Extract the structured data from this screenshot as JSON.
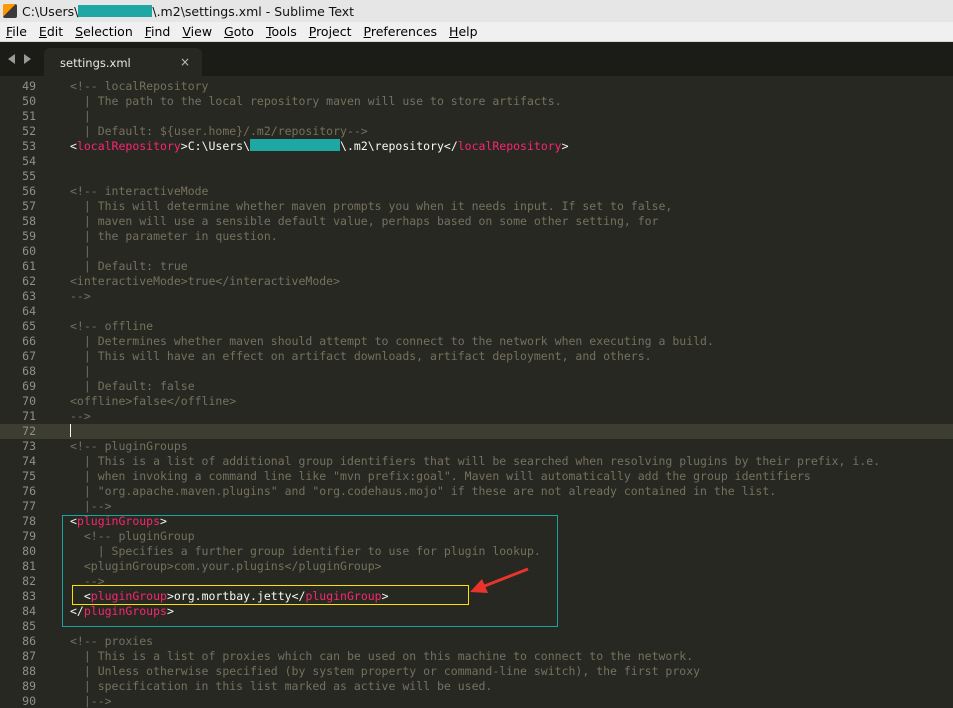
{
  "window": {
    "title_prefix": "C:\\Users\\",
    "title_suffix": "\\.m2\\settings.xml - Sublime Text"
  },
  "menu": [
    "File",
    "Edit",
    "Selection",
    "Find",
    "View",
    "Goto",
    "Tools",
    "Project",
    "Preferences",
    "Help"
  ],
  "tab": {
    "label": "settings.xml",
    "close": "×"
  },
  "editor": {
    "current_line": 72,
    "lines": [
      {
        "n": "49",
        "s": [
          [
            "c",
            "<!-- localRepository"
          ]
        ]
      },
      {
        "n": "50",
        "s": [
          [
            "c",
            "  | The path to the local repository maven will use to store artifacts."
          ]
        ]
      },
      {
        "n": "51",
        "s": [
          [
            "c",
            "  |"
          ]
        ]
      },
      {
        "n": "52",
        "s": [
          [
            "c",
            "  | Default: ${user.home}/.m2/repository-->"
          ]
        ]
      },
      {
        "n": "53",
        "s": [
          [
            "p",
            "<"
          ],
          [
            "t",
            "localRepository"
          ],
          [
            "p",
            ">C:\\Users\\"
          ],
          [
            "r",
            ""
          ],
          [
            "p",
            "\\.m2\\repository</"
          ],
          [
            "t",
            "localRepository"
          ],
          [
            "p",
            ">"
          ]
        ]
      },
      {
        "n": "54",
        "s": []
      },
      {
        "n": "55",
        "s": []
      },
      {
        "n": "56",
        "s": [
          [
            "c",
            "<!-- interactiveMode"
          ]
        ]
      },
      {
        "n": "57",
        "s": [
          [
            "c",
            "  | This will determine whether maven prompts you when it needs input. If set to false,"
          ]
        ]
      },
      {
        "n": "58",
        "s": [
          [
            "c",
            "  | maven will use a sensible default value, perhaps based on some other setting, for"
          ]
        ]
      },
      {
        "n": "59",
        "s": [
          [
            "c",
            "  | the parameter in question."
          ]
        ]
      },
      {
        "n": "60",
        "s": [
          [
            "c",
            "  |"
          ]
        ]
      },
      {
        "n": "61",
        "s": [
          [
            "c",
            "  | Default: true"
          ]
        ]
      },
      {
        "n": "62",
        "s": [
          [
            "c",
            "<interactiveMode>true</interactiveMode>"
          ]
        ]
      },
      {
        "n": "63",
        "s": [
          [
            "c",
            "-->"
          ]
        ]
      },
      {
        "n": "64",
        "s": []
      },
      {
        "n": "65",
        "s": [
          [
            "c",
            "<!-- offline"
          ]
        ]
      },
      {
        "n": "66",
        "s": [
          [
            "c",
            "  | Determines whether maven should attempt to connect to the network when executing a build."
          ]
        ]
      },
      {
        "n": "67",
        "s": [
          [
            "c",
            "  | This will have an effect on artifact downloads, artifact deployment, and others."
          ]
        ]
      },
      {
        "n": "68",
        "s": [
          [
            "c",
            "  |"
          ]
        ]
      },
      {
        "n": "69",
        "s": [
          [
            "c",
            "  | Default: false"
          ]
        ]
      },
      {
        "n": "70",
        "s": [
          [
            "c",
            "<offline>false</offline>"
          ]
        ]
      },
      {
        "n": "71",
        "s": [
          [
            "c",
            "-->"
          ]
        ]
      },
      {
        "n": "72",
        "s": []
      },
      {
        "n": "73",
        "s": [
          [
            "c",
            "<!-- pluginGroups"
          ]
        ]
      },
      {
        "n": "74",
        "s": [
          [
            "c",
            "  | This is a list of additional group identifiers that will be searched when resolving plugins by their prefix, i.e."
          ]
        ]
      },
      {
        "n": "75",
        "s": [
          [
            "c",
            "  | when invoking a command line like \"mvn prefix:goal\". Maven will automatically add the group identifiers"
          ]
        ]
      },
      {
        "n": "76",
        "s": [
          [
            "c",
            "  | \"org.apache.maven.plugins\" and \"org.codehaus.mojo\" if these are not already contained in the list."
          ]
        ]
      },
      {
        "n": "77",
        "s": [
          [
            "c",
            "  |-->"
          ]
        ]
      },
      {
        "n": "78",
        "s": [
          [
            "p",
            "<"
          ],
          [
            "t",
            "pluginGroups"
          ],
          [
            "p",
            ">"
          ]
        ]
      },
      {
        "n": "79",
        "s": [
          [
            "c",
            "  <!-- pluginGroup"
          ]
        ]
      },
      {
        "n": "80",
        "s": [
          [
            "c",
            "    | Specifies a further group identifier to use for plugin lookup."
          ]
        ]
      },
      {
        "n": "81",
        "s": [
          [
            "c",
            "  <pluginGroup>com.your.plugins</pluginGroup>"
          ]
        ]
      },
      {
        "n": "82",
        "s": [
          [
            "c",
            "  -->"
          ]
        ]
      },
      {
        "n": "83",
        "s": [
          [
            "p",
            "  <"
          ],
          [
            "t",
            "pluginGroup"
          ],
          [
            "p",
            ">org.mortbay.jetty</"
          ],
          [
            "t",
            "pluginGroup"
          ],
          [
            "p",
            ">"
          ]
        ]
      },
      {
        "n": "84",
        "s": [
          [
            "p",
            "</"
          ],
          [
            "t",
            "pluginGroups"
          ],
          [
            "p",
            ">"
          ]
        ]
      },
      {
        "n": "85",
        "s": []
      },
      {
        "n": "86",
        "s": [
          [
            "c",
            "<!-- proxies"
          ]
        ]
      },
      {
        "n": "87",
        "s": [
          [
            "c",
            "  | This is a list of proxies which can be used on this machine to connect to the network."
          ]
        ]
      },
      {
        "n": "88",
        "s": [
          [
            "c",
            "  | Unless otherwise specified (by system property or command-line switch), the first proxy"
          ]
        ]
      },
      {
        "n": "89",
        "s": [
          [
            "c",
            "  | specification in this list marked as active will be used."
          ]
        ]
      },
      {
        "n": "90",
        "s": [
          [
            "c",
            "  |-->"
          ]
        ]
      }
    ]
  },
  "colors": {
    "editor_bg": "#272822",
    "comment": "#75715e",
    "tag": "#f92672",
    "highlight_box": "#1aa3a1",
    "callout_box": "#ffe000",
    "callout_arrow": "#e8342c",
    "redaction": "#1fa7a3"
  }
}
